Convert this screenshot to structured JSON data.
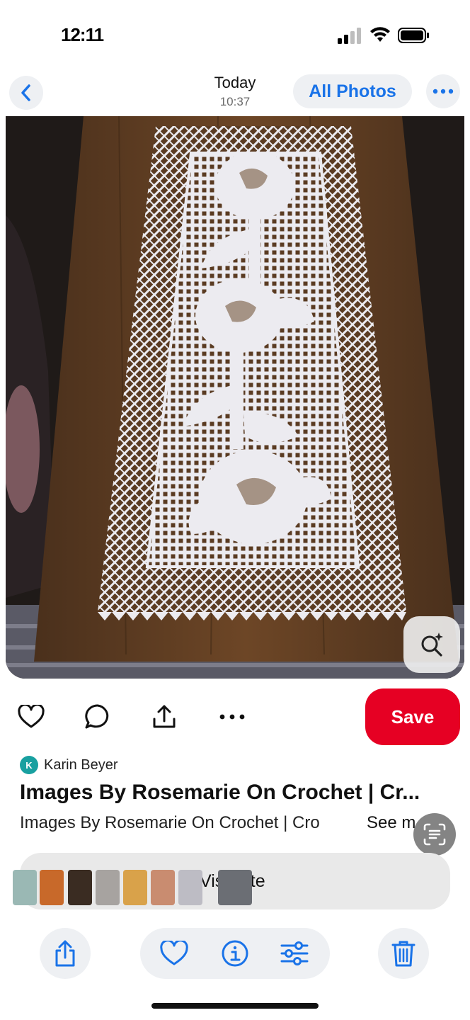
{
  "status_bar": {
    "time": "12:11",
    "icons": [
      "cellular-signal-icon",
      "wifi-icon",
      "battery-icon"
    ]
  },
  "nav": {
    "title": "Today",
    "subtitle": "10:37",
    "all_photos_label": "All Photos",
    "icons": {
      "back": "chevron-left-icon",
      "more": "ellipsis-icon"
    }
  },
  "photo": {
    "subject": "filet crochet table runner on wooden table",
    "visual_lookup_icon": "visual-lookup-icon"
  },
  "actions": {
    "icons": [
      "heart-icon",
      "comment-icon",
      "share-icon",
      "more-dots-icon"
    ],
    "save_label": "Save"
  },
  "pin": {
    "author_initial": "K",
    "author_name": "Karin Beyer",
    "title": "Images By Rosemarie On Crochet | Cr...",
    "description": "Images By Rosemarie On Crochet | Cro",
    "see_more_label": "See m"
  },
  "visit": {
    "label": "Visit site",
    "thumbnail_count": 9
  },
  "bottom_toolbar": {
    "icons": [
      "share-icon",
      "favorite-icon",
      "info-icon",
      "adjust-icon",
      "trash-icon"
    ]
  },
  "colors": {
    "accent_blue": "#1a73e8",
    "save_red": "#e60023",
    "avatar_teal": "#18a0a0",
    "pill_bg": "#eef0f3"
  }
}
